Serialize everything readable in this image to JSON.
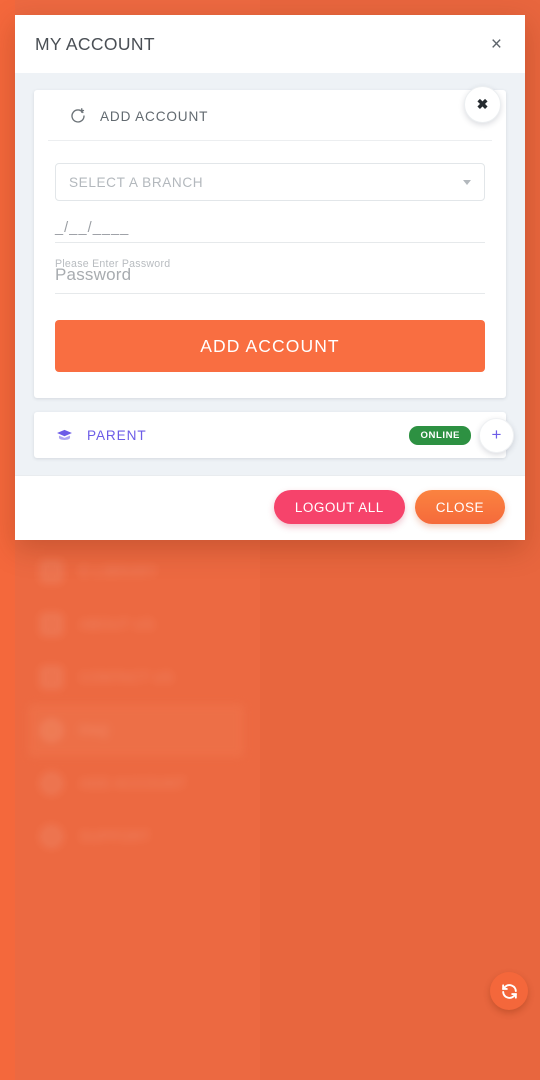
{
  "theme": {
    "accent_orange": "#f96e41",
    "page_background": "#ec6941",
    "purple": "#6c5ce7",
    "status_green": "#2d9142",
    "pink": "#f6436b",
    "body_background": "#eef2f6"
  },
  "modal": {
    "title": "MY ACCOUNT",
    "close_icon": "close-icon",
    "close_icon_glyph": "×"
  },
  "add_account_card": {
    "icon": "add-account-refresh-icon",
    "label": "ADD ACCOUNT",
    "dismiss_icon": "close-icon",
    "dismiss_glyph": "✖",
    "form": {
      "branch_select": {
        "label": "SELECT A BRANCH",
        "value": "",
        "placeholder": "SELECT A BRANCH",
        "caret_icon": "chevron-down-icon",
        "options": [
          "SELECT A BRANCH"
        ]
      },
      "date_field": {
        "value": "_/__/____",
        "placeholder": "_/__/____"
      },
      "password_field": {
        "float_label": "Please Enter Password",
        "placeholder": "Password",
        "value": ""
      },
      "submit_label": "ADD ACCOUNT"
    }
  },
  "account_list": [
    {
      "icon": "graduation-cap-icon",
      "name": "PARENT",
      "status": "ONLINE",
      "add_icon": "plus-icon",
      "add_glyph": "+"
    }
  ],
  "footer": {
    "logout_all_label": "LOGOUT ALL",
    "close_label": "CLOSE"
  },
  "background_app": {
    "nav_items": [
      {
        "label": "E-LIBRARY",
        "icon": "library-icon",
        "active": false,
        "shape": "square"
      },
      {
        "label": "ABOUT US",
        "icon": "info-card-icon",
        "active": false,
        "shape": "square"
      },
      {
        "label": "CONTACT US",
        "icon": "contact-icon",
        "active": false,
        "shape": "square"
      },
      {
        "label": "FAQ",
        "icon": "question-icon",
        "active": true,
        "shape": "round"
      },
      {
        "label": "ADD ACCOUNT",
        "icon": "add-account-icon",
        "active": false,
        "shape": "round"
      },
      {
        "label": "SUPPORT",
        "icon": "support-icon",
        "active": false,
        "shape": "round"
      }
    ],
    "fab": {
      "icon": "refresh-icon",
      "label": ""
    }
  }
}
